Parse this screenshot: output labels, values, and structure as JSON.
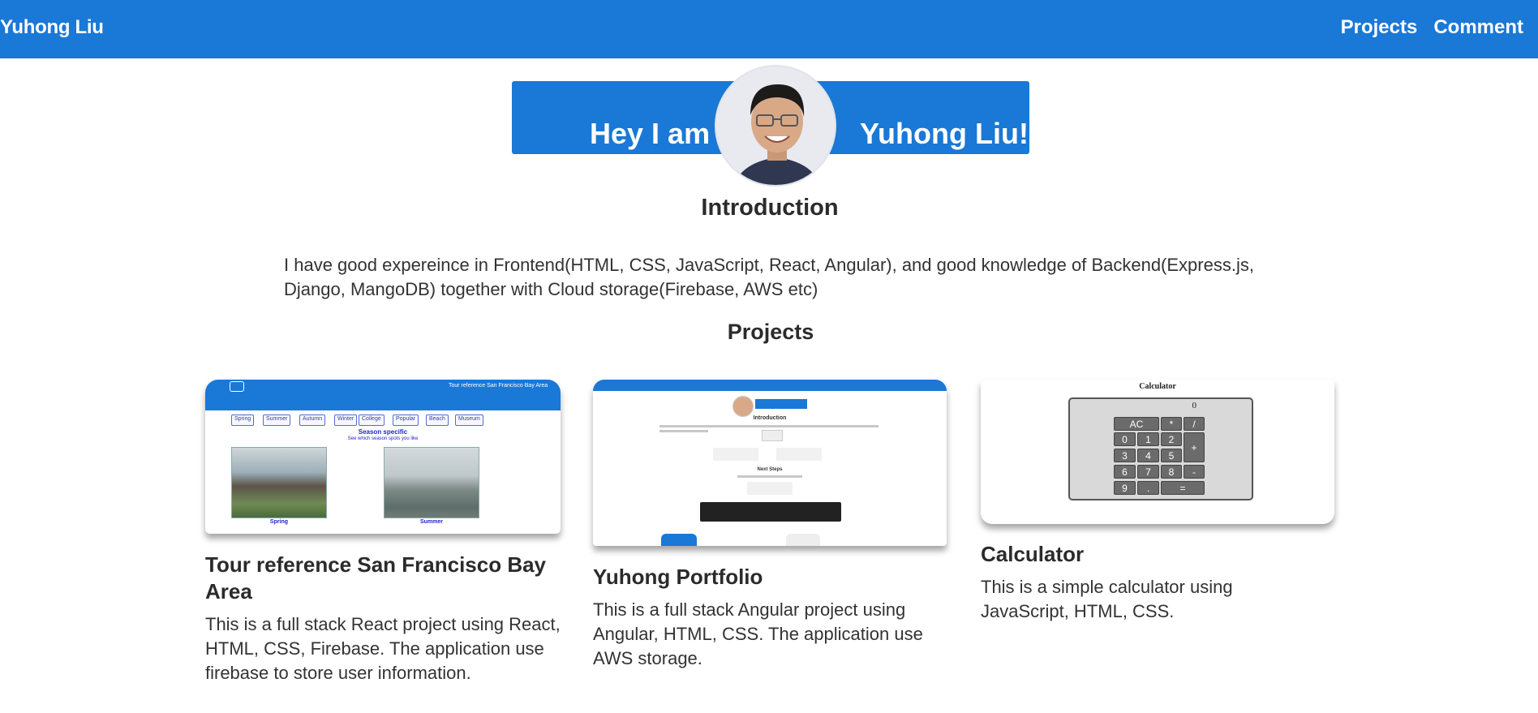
{
  "nav": {
    "brand": "Yuhong Liu",
    "links": [
      "Projects",
      "Comment"
    ]
  },
  "hero": {
    "left_text": "Hey I am",
    "right_text": "Yuhong Liu!"
  },
  "intro": {
    "title": "Introduction",
    "text": "I have good expereince in Frontend(HTML, CSS, JavaScript, React, Angular), and good knowledge of Backend(Express.js, Django, MangoDB) together with Cloud storage(Firebase, AWS etc)"
  },
  "projects": {
    "title": "Projects",
    "cards": [
      {
        "title": "Tour reference San Francisco Bay Area",
        "description": "This is a full stack React project using React, HTML, CSS, Firebase. The application use firebase to store user information.",
        "thumb": {
          "header": "Tour reference San Francisco Bay Area",
          "chips": [
            "Spring",
            "Summer",
            "Autumn",
            "Winter",
            "College",
            "Popular",
            "Beach",
            "Museum"
          ],
          "heading": "Season specific",
          "subheading": "See which season spots you like",
          "photo_captions": [
            "Spring",
            "Summer"
          ]
        }
      },
      {
        "title": "Yuhong Portfolio",
        "description": "This is a full stack Angular project using Angular, HTML, CSS. The application use AWS storage.",
        "thumb": {
          "heading": "Introduction",
          "subheading": "Next Steps"
        }
      },
      {
        "title": "Calculator",
        "description": "This is a simple calculator using JavaScript, HTML, CSS.",
        "thumb": {
          "heading": "Calculator",
          "display": "0",
          "keys": [
            "AC",
            "*",
            "/",
            "0",
            "1",
            "2",
            "+",
            "3",
            "4",
            "5",
            "6",
            "7",
            "8",
            "-",
            "9",
            ".",
            "="
          ]
        }
      }
    ]
  },
  "colors": {
    "primary": "#1a78d6",
    "text": "#2b2b2b",
    "calc_key": "#6b6b6b"
  }
}
